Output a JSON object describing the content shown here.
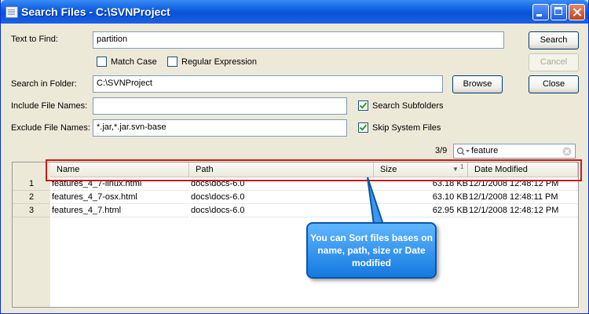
{
  "window": {
    "title": "Search Files - C:\\SVNProject"
  },
  "form": {
    "text_to_find_label": "Text to Find:",
    "text_to_find_value": "partition",
    "match_case_label": "Match Case",
    "match_case_checked": false,
    "regex_label": "Regular Expression",
    "regex_checked": false,
    "search_in_label": "Search in Folder:",
    "search_in_value": "C:\\SVNProject",
    "include_label": "Include File Names:",
    "include_value": "",
    "exclude_label": "Exclude File Names:",
    "exclude_value": "*.jar,*.jar.svn-base",
    "search_sub_label": "Search Subfolders",
    "search_sub_checked": true,
    "skip_sys_label": "Skip System Files",
    "skip_sys_checked": true
  },
  "buttons": {
    "search": "Search",
    "cancel": "Cancel",
    "browse": "Browse",
    "close": "Close"
  },
  "filter": {
    "counter": "3/9",
    "value": "feature"
  },
  "table": {
    "columns": [
      "Name",
      "Path",
      "Size",
      "Date Modified"
    ],
    "sort_indicator": "1",
    "rows": [
      {
        "num": "1",
        "name": "features_4_7-linux.html",
        "path": "docs\\docs-6.0",
        "size": "63.18 KB",
        "date": "12/1/2008 12:48:12 PM"
      },
      {
        "num": "2",
        "name": "features_4_7-osx.html",
        "path": "docs\\docs-6.0",
        "size": "63.10 KB",
        "date": "12/1/2008 12:48:11 PM"
      },
      {
        "num": "3",
        "name": "features_4_7.html",
        "path": "docs\\docs-6.0",
        "size": "62.95 KB",
        "date": "12/1/2008 12:48:12 PM"
      }
    ]
  },
  "callout": {
    "text": "You can Sort files bases on name, path, size or Date modified"
  },
  "colors": {
    "title_bar": "#0a52d6",
    "highlight": "#c81a1a",
    "callout": "#1479e0"
  },
  "icons": {
    "app": "window-icon",
    "filter": "search-icon",
    "clear": "clear-icon",
    "sort": "sort-descending-icon"
  }
}
